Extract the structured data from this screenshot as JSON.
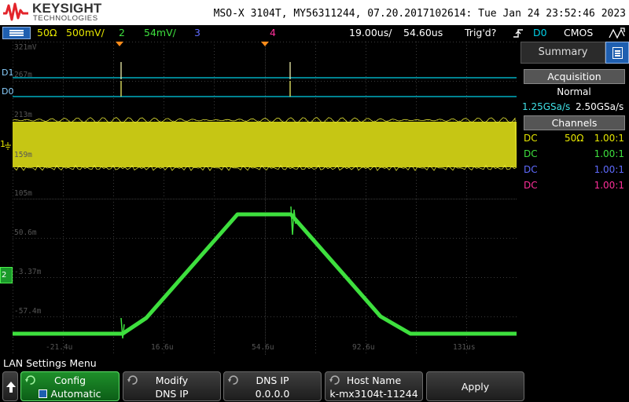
{
  "header": {
    "brand": "KEYSIGHT",
    "brand_sub": "TECHNOLOGIES",
    "instrument": "MSO-X 3104T, MY56311244, 07.20.2017102614: Tue Jan 24 23:52:46 2023"
  },
  "status_bar": {
    "ch1_impedance": "50Ω",
    "ch1_scale": "500mV/",
    "ch2_label": "2",
    "ch2_scale": "54mV/",
    "ch3_label": "3",
    "ch4_label": "4",
    "timebase": "19.00us/",
    "delay": "54.60us",
    "trigger_status": "Trig'd?",
    "trigger_source": "D0",
    "trigger_level": "CMOS"
  },
  "grid": {
    "y_labels": [
      "321mV",
      "267m",
      "213m",
      "159m",
      "105m",
      "50.6m",
      "-3.37m",
      "-57.4m"
    ],
    "x_labels": [
      "-21.4u",
      "16.6u",
      "54.6u",
      "92.6u",
      "131us"
    ],
    "markers": {
      "d1": "D1",
      "d0": "D0",
      "ch1": "1",
      "ch2": "2"
    }
  },
  "colors": {
    "ch1": "#e6e600",
    "ch2": "#3ee03e",
    "ch3": "#5f6bff",
    "ch4": "#ff2f9a",
    "digital": "#00cfe6",
    "grid": "#3a3a3a"
  },
  "panel": {
    "tab": "Summary",
    "acquisition_title": "Acquisition",
    "acquisition_mode": "Normal",
    "sample_rate_1": "1.25GSa/s",
    "sample_rate_2": "2.50GSa/s",
    "channels_title": "Channels",
    "channels": [
      {
        "coupling": "DC",
        "impedance": "50Ω",
        "probe": "1.00:1"
      },
      {
        "coupling": "DC",
        "impedance": "",
        "probe": "1.00:1"
      },
      {
        "coupling": "DC",
        "impedance": "",
        "probe": "1.00:1"
      },
      {
        "coupling": "DC",
        "impedance": "",
        "probe": "1.00:1"
      }
    ]
  },
  "menu": {
    "title": "LAN Settings Menu",
    "config_label": "Config",
    "config_value": "Automatic",
    "modify_label": "Modify",
    "modify_value": "DNS IP",
    "dns_label": "DNS IP",
    "dns_value": "0.0.0.0",
    "host_label": "Host Name",
    "host_value": "k-mx3104t-11244",
    "apply_label": "Apply"
  },
  "icons": {
    "menu_toggle": "channel-menu-icon",
    "trigger_edge": "rising-edge-icon",
    "run_mode": "auto-trigger-icon"
  }
}
